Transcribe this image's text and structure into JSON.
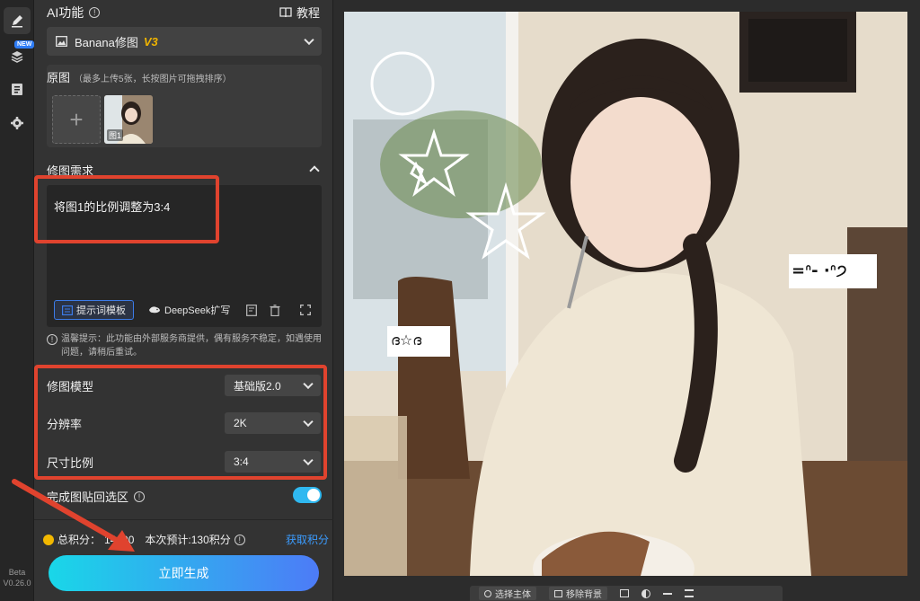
{
  "rail": {
    "new_badge": "NEW",
    "version": "Beta\nV0.26.0"
  },
  "header": {
    "title": "AI功能",
    "tutorial": "教程"
  },
  "feature_select": {
    "name": "Banana修图",
    "version_tag": "V3"
  },
  "source_images": {
    "title": "原图",
    "hint": "（最多上传5张，长按图片可拖拽排序）",
    "thumb_label": "图1"
  },
  "request": {
    "title": "修图需求",
    "prompt": "将图1的比例调整为3:4",
    "template_button": "提示词模板",
    "deepseek_button": "DeepSeek扩写"
  },
  "notice": "温馨提示：此功能由外部服务商提供，偶有服务不稳定，如遇使用问题，请稍后重试。",
  "options": {
    "model_label": "修图模型",
    "model_value": "基础版2.0",
    "resolution_label": "分辨率",
    "resolution_value": "2K",
    "ratio_label": "尺寸比例",
    "ratio_value": "3:4",
    "paste_back_label": "完成图贴回选区"
  },
  "credits": {
    "total_label": "总积分：",
    "total_value": "14400",
    "estimate": "本次预计:130积分",
    "get_link": "获取积分"
  },
  "generate_button": "立即生成",
  "canvas": {
    "sticker_right": "=ᐢ- ·ᐢ੭",
    "sticker_left": "ദ☆ദ",
    "toolbar_select_subject": "选择主体",
    "toolbar_remove_bg": "移除背景"
  },
  "colors": {
    "accent_blue": "#3c7be8",
    "highlight_red": "#e0432e",
    "toggle_on": "#2fb8f0",
    "coin": "#f2b800"
  }
}
